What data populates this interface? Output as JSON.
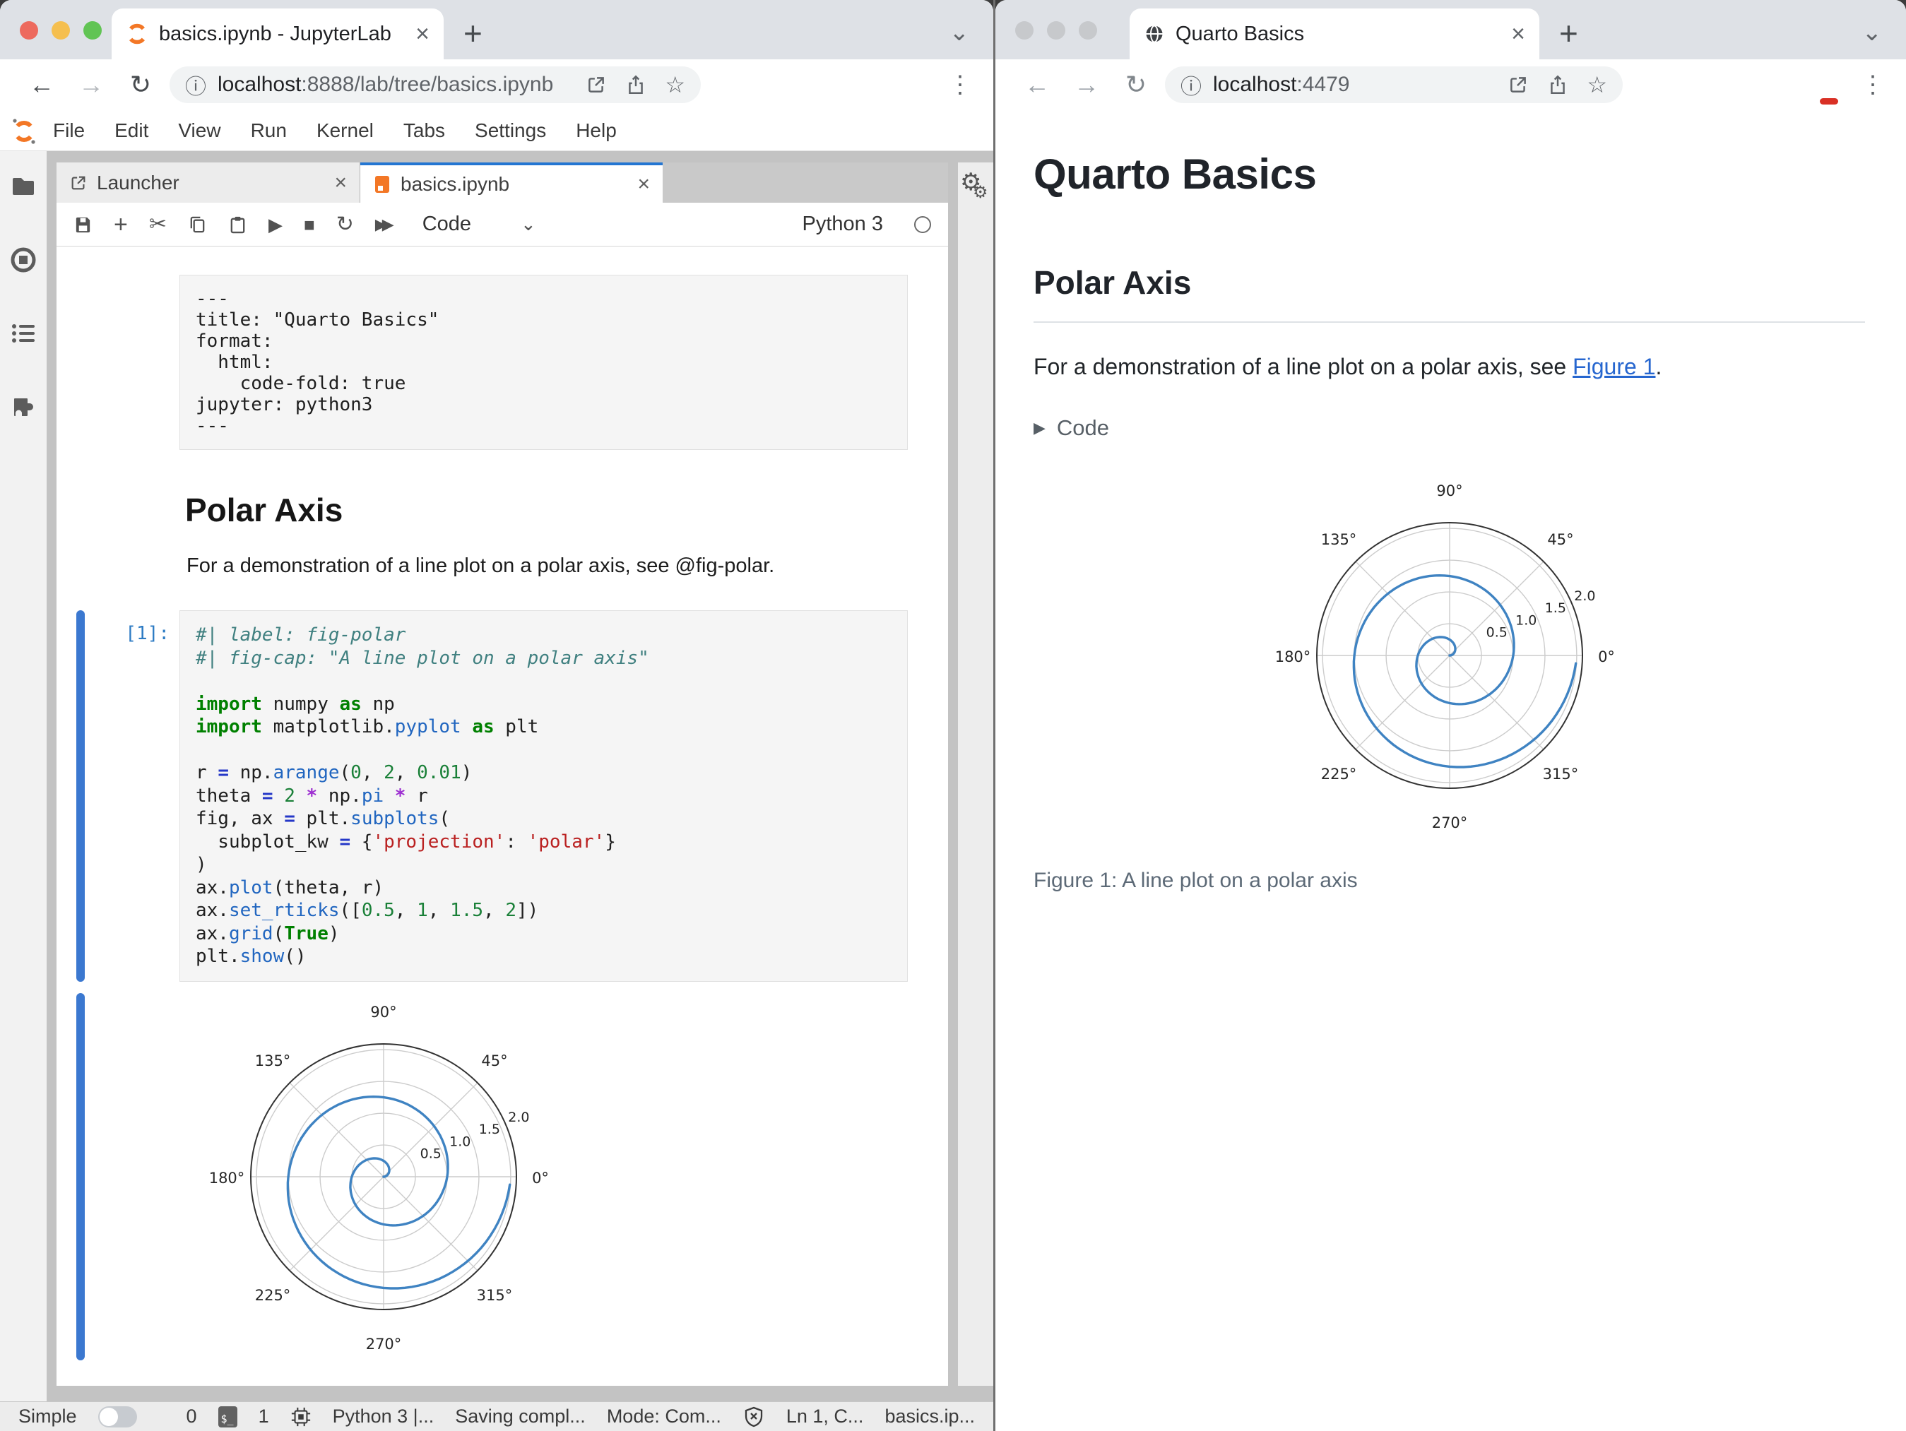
{
  "icons": {
    "back": "←",
    "forward": "→",
    "reload": "↻",
    "info": "ⓘ",
    "star": "☆",
    "more": "⋮",
    "chevron_down": "⌄",
    "new_tab": "+",
    "close": "×",
    "cut": "✂",
    "play": "▶",
    "stop": "■",
    "refresh": "↻",
    "run_all": "▶▶",
    "dropdown": "⌄",
    "gear": "⚙",
    "terminal_prompt": "$_",
    "fold_caret": "▶"
  },
  "left_window": {
    "browser_tab_title": "basics.ipynb - JupyterLab",
    "url_host": "localhost",
    "url_path": ":8888/lab/tree/basics.ipynb",
    "menu_items": [
      "File",
      "Edit",
      "View",
      "Run",
      "Kernel",
      "Tabs",
      "Settings",
      "Help"
    ],
    "doc_tabs": {
      "launcher": "Launcher",
      "notebook": "basics.ipynb"
    },
    "toolbar": {
      "cell_type": "Code",
      "kernel_name": "Python 3"
    },
    "yaml_cell_lines": [
      "---",
      "title: \"Quarto Basics\"",
      "format:",
      "  html:",
      "    code-fold: true",
      "jupyter: python3",
      "---"
    ],
    "markdown_cell": {
      "heading": "Polar Axis",
      "paragraph": "For a demonstration of a line plot on a polar axis, see @fig-polar."
    },
    "code_cell": {
      "prompt": "[1]:",
      "lines": [
        [
          [
            "c",
            "#| label: fig-polar"
          ]
        ],
        [
          [
            "c",
            "#| fig-cap: \"A line plot on a polar axis\""
          ]
        ],
        [],
        [
          [
            "k",
            "import"
          ],
          [
            "p",
            " numpy "
          ],
          [
            "k",
            "as"
          ],
          [
            "p",
            " np"
          ]
        ],
        [
          [
            "k",
            "import"
          ],
          [
            "p",
            " matplotlib."
          ],
          [
            "f",
            "pyplot"
          ],
          [
            "p",
            " "
          ],
          [
            "k",
            "as"
          ],
          [
            "p",
            " plt"
          ]
        ],
        [],
        [
          [
            "p",
            "r "
          ],
          [
            "e",
            "="
          ],
          [
            "p",
            " np."
          ],
          [
            "f",
            "arange"
          ],
          [
            "p",
            "("
          ],
          [
            "n",
            "0"
          ],
          [
            "p",
            ", "
          ],
          [
            "n",
            "2"
          ],
          [
            "p",
            ", "
          ],
          [
            "n",
            "0.01"
          ],
          [
            "p",
            ")"
          ]
        ],
        [
          [
            "p",
            "theta "
          ],
          [
            "e",
            "="
          ],
          [
            "p",
            " "
          ],
          [
            "n",
            "2"
          ],
          [
            "p",
            " "
          ],
          [
            "o",
            "*"
          ],
          [
            "p",
            " np."
          ],
          [
            "f",
            "pi"
          ],
          [
            "p",
            " "
          ],
          [
            "o",
            "*"
          ],
          [
            "p",
            " r"
          ]
        ],
        [
          [
            "p",
            "fig, ax "
          ],
          [
            "e",
            "="
          ],
          [
            "p",
            " plt."
          ],
          [
            "f",
            "subplots"
          ],
          [
            "p",
            "("
          ]
        ],
        [
          [
            "p",
            "  subplot_kw "
          ],
          [
            "e",
            "="
          ],
          [
            "p",
            " {"
          ],
          [
            "s",
            "'projection'"
          ],
          [
            "p",
            ": "
          ],
          [
            "s",
            "'polar'"
          ],
          [
            "p",
            "}"
          ]
        ],
        [
          [
            "p",
            ")"
          ]
        ],
        [
          [
            "p",
            "ax."
          ],
          [
            "f",
            "plot"
          ],
          [
            "p",
            "(theta, r)"
          ]
        ],
        [
          [
            "p",
            "ax."
          ],
          [
            "f",
            "set_rticks"
          ],
          [
            "p",
            "(["
          ],
          [
            "n",
            "0.5"
          ],
          [
            "p",
            ", "
          ],
          [
            "n",
            "1"
          ],
          [
            "p",
            ", "
          ],
          [
            "n",
            "1.5"
          ],
          [
            "p",
            ", "
          ],
          [
            "n",
            "2"
          ],
          [
            "p",
            "])"
          ]
        ],
        [
          [
            "p",
            "ax."
          ],
          [
            "f",
            "grid"
          ],
          [
            "p",
            "("
          ],
          [
            "k",
            "True"
          ],
          [
            "p",
            ")"
          ]
        ],
        [
          [
            "p",
            "plt."
          ],
          [
            "f",
            "show"
          ],
          [
            "p",
            "()"
          ]
        ]
      ]
    },
    "statusbar": {
      "simple_label": "Simple",
      "terminal_count": "0",
      "kernel_count": "1",
      "kernel_status": "Python 3 |...",
      "saving": "Saving compl...",
      "mode": "Mode: Com...",
      "cursor": "Ln 1, C...",
      "filename": "basics.ip..."
    }
  },
  "right_window": {
    "browser_tab_title": "Quarto Basics",
    "url_host": "localhost",
    "url_path": ":4479",
    "page": {
      "title": "Quarto Basics",
      "section_heading": "Polar Axis",
      "para_before": "For a demonstration of a line plot on a polar axis, see ",
      "para_link": "Figure 1",
      "para_after": ".",
      "code_fold_label": "Code",
      "figure_caption": "Figure 1: A line plot on a polar axis"
    }
  },
  "chart_data": {
    "type": "line",
    "projection": "polar",
    "title": "",
    "description": "Archimedean spiral: theta = 2*pi*r, r from 0 to 2 in steps of 0.01 (two full turns ending at r=2 just below the 0-degree axis)",
    "r_formula": "theta = 2 * pi * r",
    "r_start": 0,
    "r_end": 2,
    "r_step": 0.01,
    "r_ticks": [
      0.5,
      1.0,
      1.5,
      2.0
    ],
    "r_tick_labels": [
      "0.5",
      "1.0",
      "1.5",
      "2.0"
    ],
    "r_max_boundary": 2.09,
    "r_label_angle_deg": 22.5,
    "theta_ticks_deg": [
      0,
      45,
      90,
      135,
      180,
      225,
      270,
      315
    ],
    "theta_tick_labels": [
      "0°",
      "45°",
      "90°",
      "135°",
      "180°",
      "225°",
      "270°",
      "315°"
    ],
    "line_color": "#3f83c2",
    "grid_color": "#cccccc",
    "boundary_color": "#333333",
    "grid": true,
    "legend": false
  }
}
